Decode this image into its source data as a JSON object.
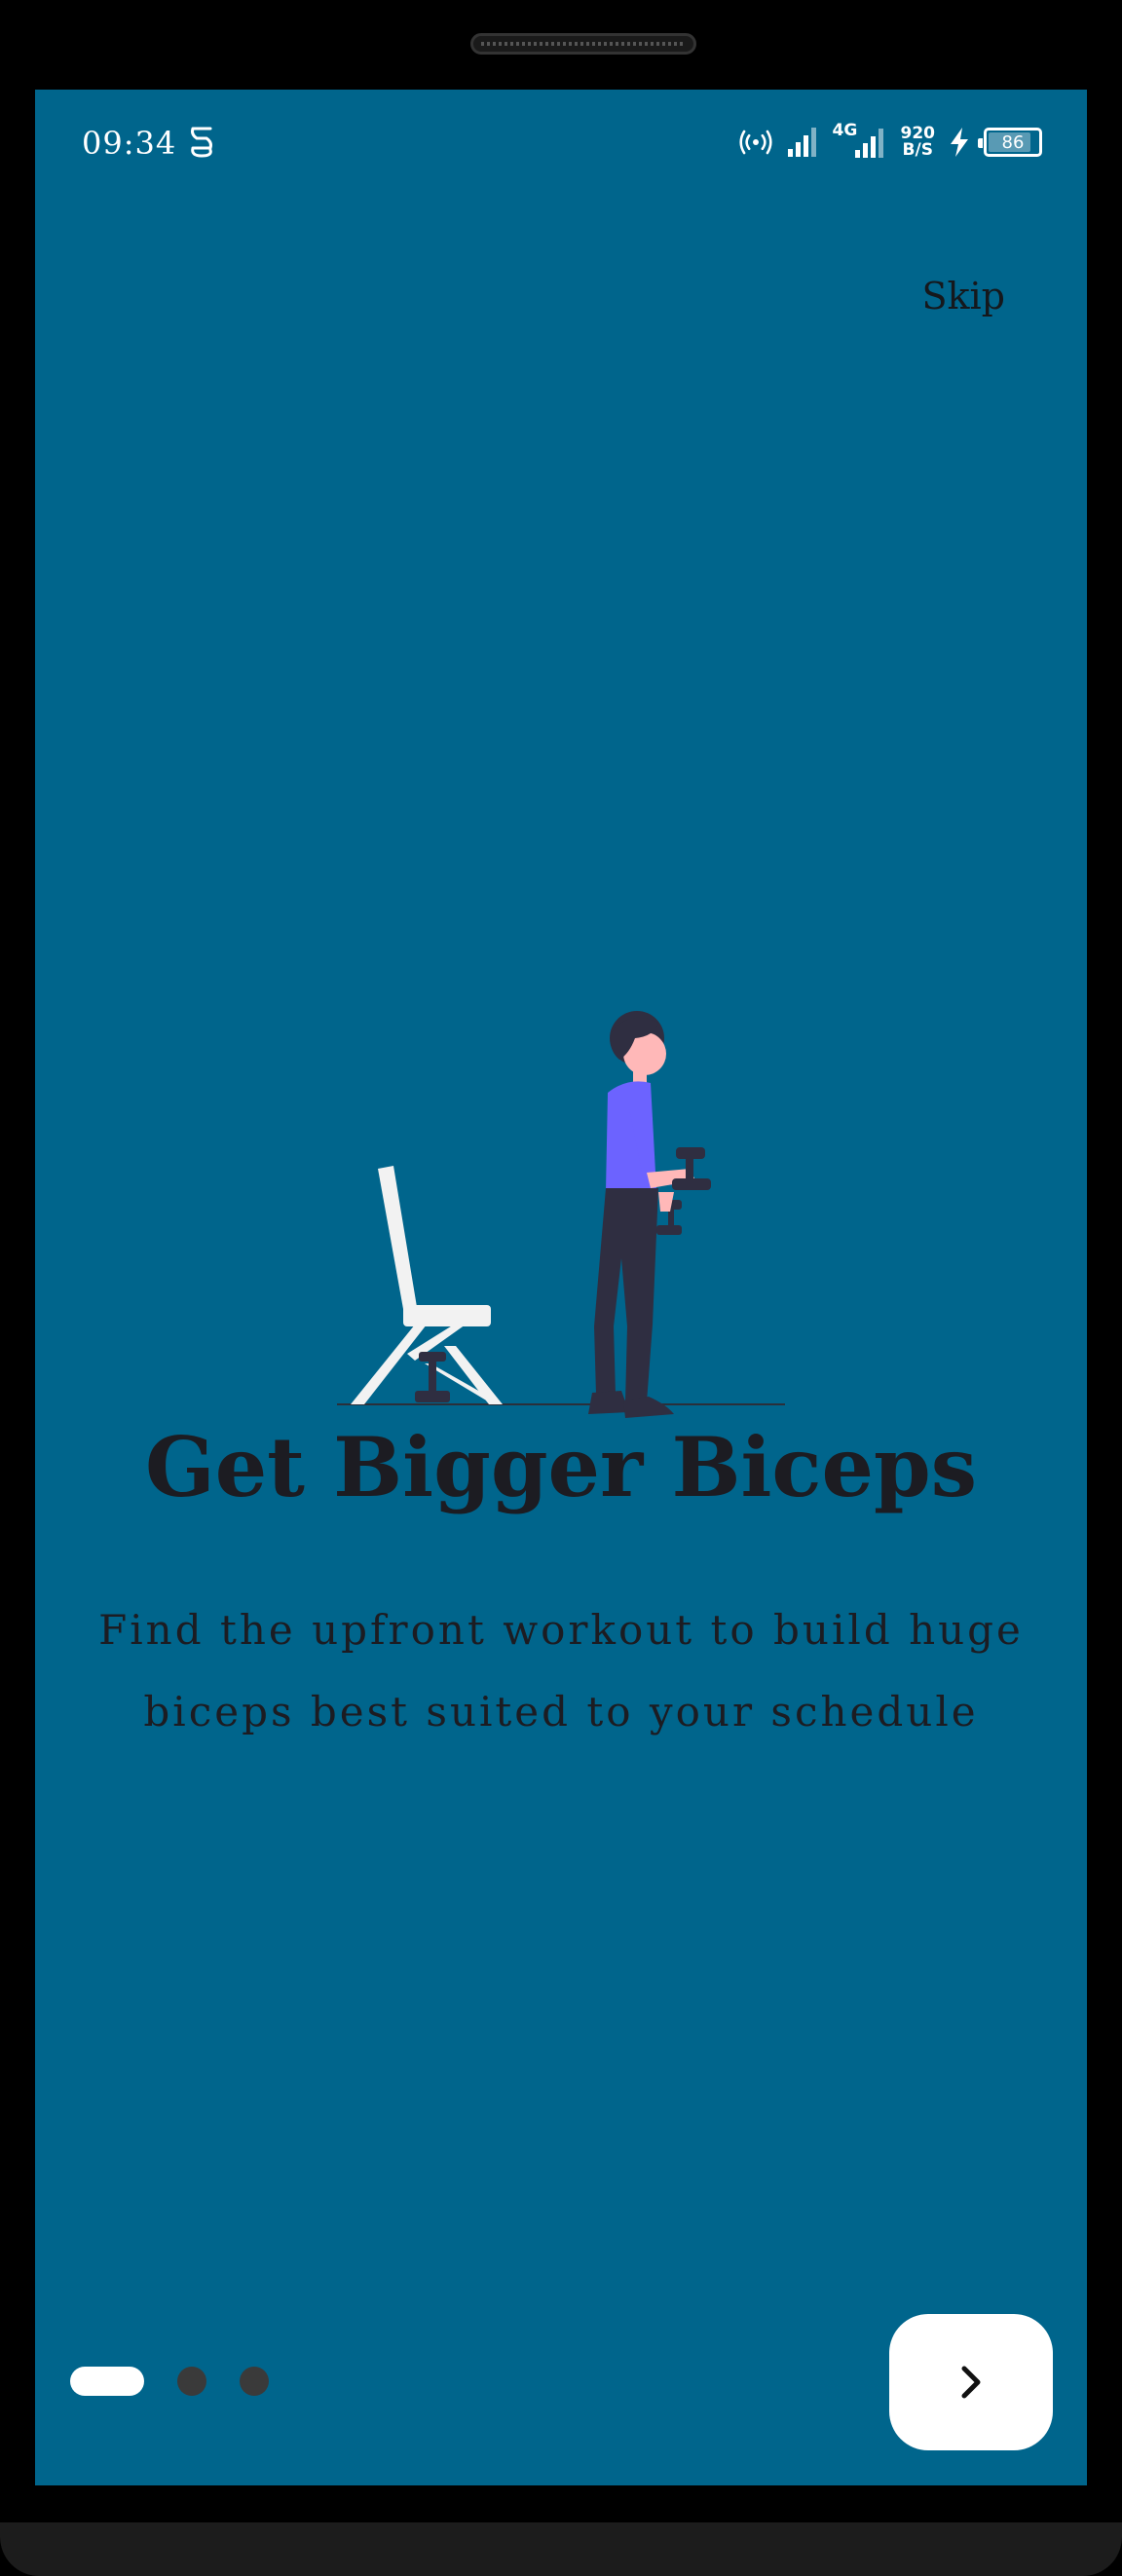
{
  "status_bar": {
    "time": "09:34",
    "network_type": "4G",
    "speed_value": "920",
    "speed_unit": "B/S",
    "battery_level": "86",
    "icons": [
      "hotspot-icon",
      "signal-icon",
      "signal-4g-icon",
      "charging-icon",
      "battery-icon"
    ]
  },
  "onboarding": {
    "skip_label": "Skip",
    "title": "Get Bigger Biceps",
    "subtitle": "Find the upfront workout to build huge biceps best suited to your schedule",
    "page_count": 3,
    "current_page": 1,
    "next_icon": "chevron-right-icon"
  },
  "colors": {
    "background": "#00658C",
    "text": "#1c1c22",
    "accent_shirt": "#6C63FF",
    "indicator_active": "#ffffff",
    "indicator_inactive": "#3a3a3a"
  }
}
